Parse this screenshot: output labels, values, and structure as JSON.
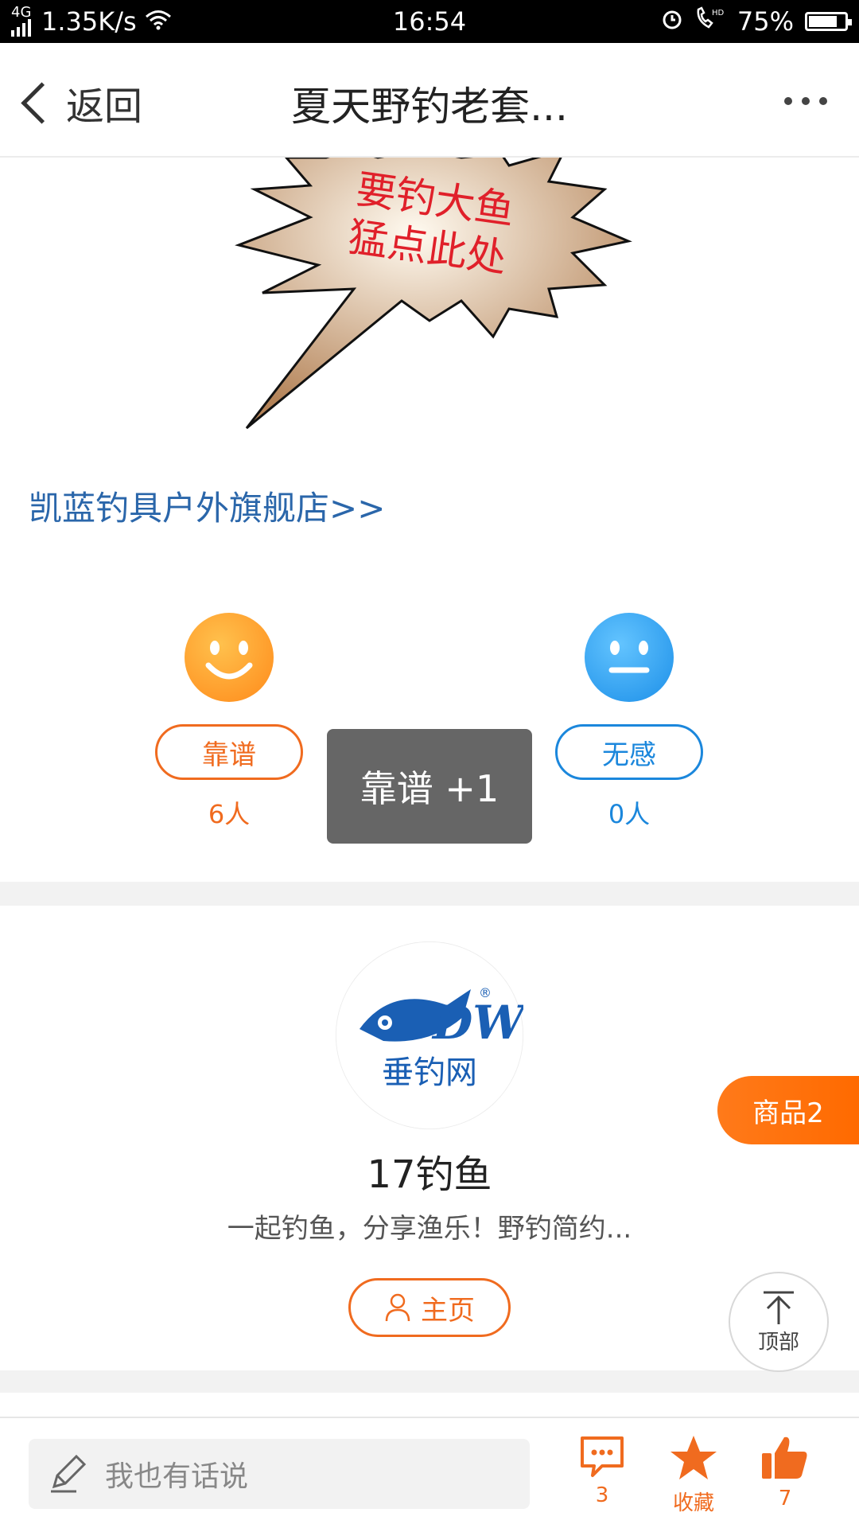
{
  "status_bar": {
    "network": "4G",
    "speed": "1.35K/s",
    "time": "16:54",
    "battery": "75%"
  },
  "nav": {
    "back_label": "返回",
    "title": "夏天野钓老套..."
  },
  "banner": {
    "line1": "要钓大鱼",
    "line2": "猛点此处"
  },
  "shop_link": "凯蓝钓具户外旗舰店>>",
  "feedback": {
    "positive_label": "靠谱",
    "positive_count": "6人",
    "neutral_label": "无感",
    "neutral_count": "0人",
    "toast": "靠谱 +1"
  },
  "author": {
    "logo_text": "垂钓网",
    "logo_letters": "DW",
    "name": "17钓鱼",
    "description": "一起钓鱼，分享渔乐！野钓简约...",
    "home_label": "主页"
  },
  "goods_tab": "商品2",
  "top_button": "顶部",
  "bottom_bar": {
    "placeholder": "我也有话说",
    "comment_count": "3",
    "favorite_label": "收藏",
    "like_count": "7"
  },
  "colors": {
    "accent_orange": "#f06b1f",
    "accent_blue": "#1b87dc",
    "link_blue": "#2a66aa"
  }
}
